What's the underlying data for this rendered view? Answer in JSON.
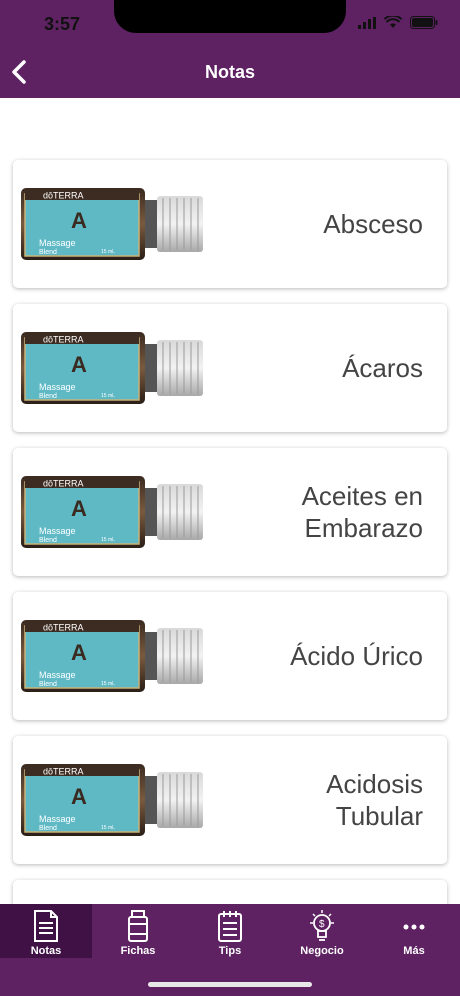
{
  "status": {
    "time": "3:57"
  },
  "header": {
    "title": "Notas"
  },
  "brand": {
    "bar_color": "#5e2263",
    "active_tab_color": "#3f1145"
  },
  "product_label": {
    "brand": "dōTERRA",
    "letter": "A",
    "line1": "Massage",
    "line2": "Blend",
    "volume": "15 mL"
  },
  "notes": [
    {
      "label": "Absceso"
    },
    {
      "label": "Ácaros"
    },
    {
      "label": "Aceites en\nEmbarazo"
    },
    {
      "label": "Ácido Úrico"
    },
    {
      "label": "Acidosis\nTubular"
    }
  ],
  "tabs": [
    {
      "label": "Notas",
      "icon": "notes-icon",
      "active": true
    },
    {
      "label": "Fichas",
      "icon": "bottle-icon"
    },
    {
      "label": "Tips",
      "icon": "notepad-icon"
    },
    {
      "label": "Negocio",
      "icon": "lightbulb-icon"
    },
    {
      "label": "Más",
      "icon": "more-icon"
    }
  ]
}
